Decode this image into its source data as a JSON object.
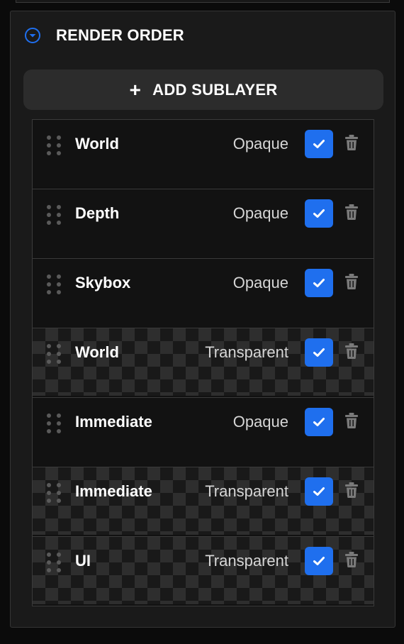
{
  "section": {
    "title": "RENDER ORDER",
    "collapse_icon": "chevron-down-circle-icon",
    "accent_color": "#1f6fee"
  },
  "add_button": {
    "label": "ADD SUBLAYER",
    "icon": "plus-icon"
  },
  "sublayers": [
    {
      "name": "World",
      "mode": "Opaque",
      "enabled": true,
      "transparent": false
    },
    {
      "name": "Depth",
      "mode": "Opaque",
      "enabled": true,
      "transparent": false
    },
    {
      "name": "Skybox",
      "mode": "Opaque",
      "enabled": true,
      "transparent": false
    },
    {
      "name": "World",
      "mode": "Transparent",
      "enabled": true,
      "transparent": true
    },
    {
      "name": "Immediate",
      "mode": "Opaque",
      "enabled": true,
      "transparent": false
    },
    {
      "name": "Immediate",
      "mode": "Transparent",
      "enabled": true,
      "transparent": true
    },
    {
      "name": "UI",
      "mode": "Transparent",
      "enabled": true,
      "transparent": true
    }
  ],
  "colors": {
    "checkbox": "#1f6fee",
    "trash": "#7a7a7a",
    "handle": "#5a5a5a"
  }
}
